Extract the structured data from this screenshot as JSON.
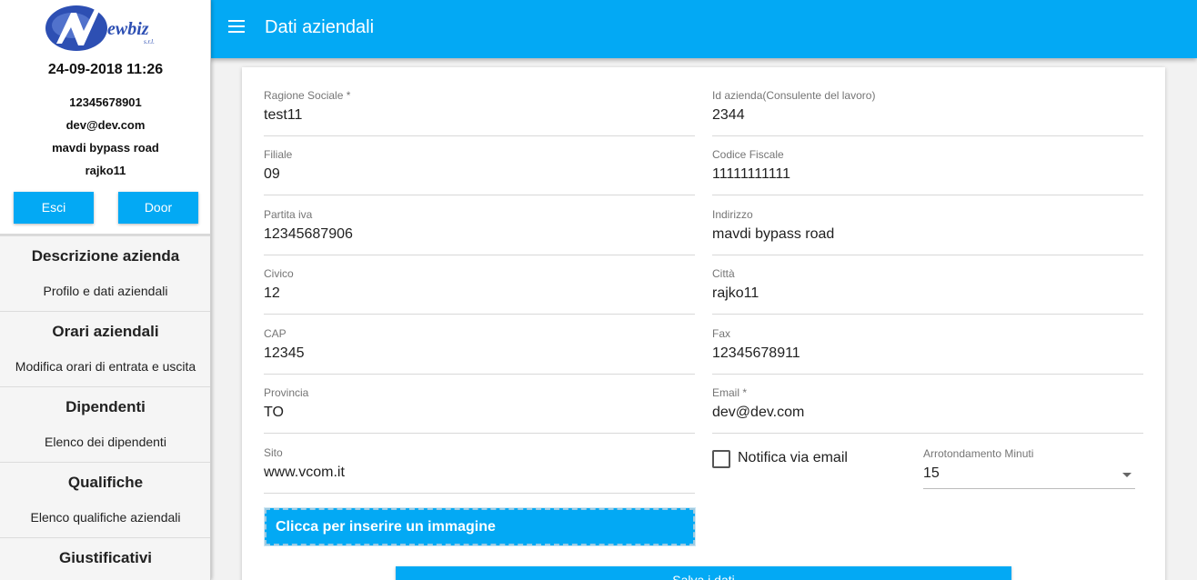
{
  "sidebar": {
    "logo_text": "Newbiz s.r.l.",
    "datetime": "24-09-2018 11:26",
    "info": [
      "12345678901",
      "dev@dev.com",
      "mavdi bypass road",
      "rajko11"
    ],
    "buttons": {
      "logout": "Esci",
      "door": "Door"
    },
    "sections": [
      {
        "title": "Descrizione azienda",
        "sub": "Profilo e dati aziendali"
      },
      {
        "title": "Orari aziendali",
        "sub": "Modifica orari di entrata e uscita"
      },
      {
        "title": "Dipendenti",
        "sub": "Elenco dei dipendenti"
      },
      {
        "title": "Qualifiche",
        "sub": "Elenco qualifiche aziendali"
      },
      {
        "title": "Giustificativi",
        "sub": ""
      }
    ]
  },
  "header": {
    "title": "Dati aziendali"
  },
  "form": {
    "left": [
      {
        "label": "Ragione Sociale *",
        "value": "test11"
      },
      {
        "label": "Filiale",
        "value": "09"
      },
      {
        "label": "Partita iva",
        "value": "12345687906"
      },
      {
        "label": "Civico",
        "value": "12"
      },
      {
        "label": "CAP",
        "value": "12345"
      },
      {
        "label": "Provincia",
        "value": "TO"
      },
      {
        "label": "Sito",
        "value": "www.vcom.it"
      }
    ],
    "right": [
      {
        "label": "Id azienda(Consulente del lavoro)",
        "value": "2344"
      },
      {
        "label": "Codice Fiscale",
        "value": "11111111111"
      },
      {
        "label": "Indirizzo",
        "value": "mavdi bypass road"
      },
      {
        "label": "Città",
        "value": "rajko11"
      },
      {
        "label": "Fax",
        "value": "12345678911"
      },
      {
        "label": "Email *",
        "value": "dev@dev.com"
      }
    ],
    "notify_label": "Notifica via email",
    "notify_checked": false,
    "rounding": {
      "label": "Arrotondamento Minuti",
      "value": "15"
    },
    "upload_label": "Clicca per inserire un immagine",
    "save_label": "Salva i dati"
  },
  "colors": {
    "primary": "#03a9f4",
    "logo_blue": "#2d4fb3"
  },
  "icons": {
    "menu": "hamburger-menu-icon",
    "select": "chevron-down-icon",
    "checkbox": "checkbox-unchecked-icon"
  }
}
